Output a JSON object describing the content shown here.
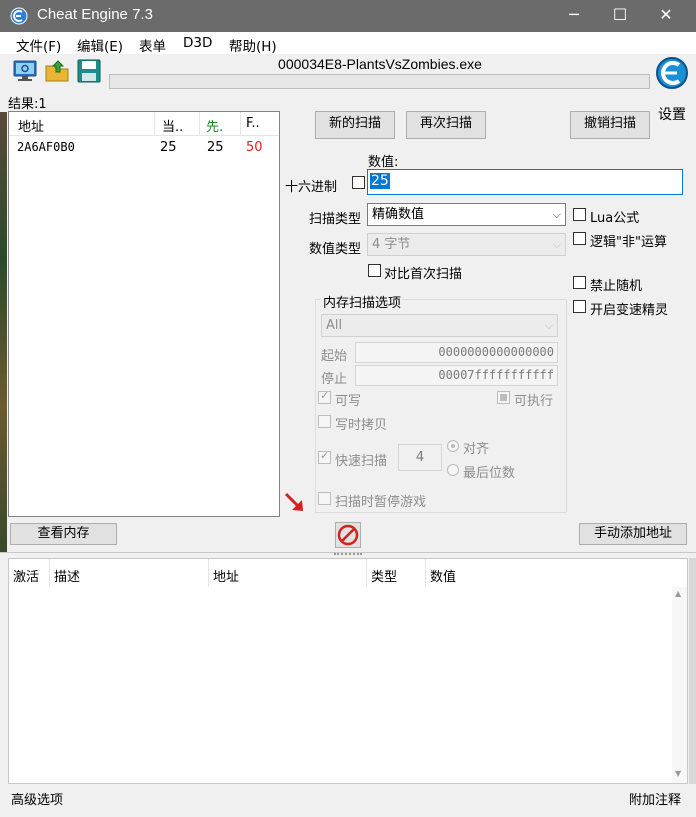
{
  "window": {
    "title": "Cheat Engine 7.3",
    "min": "─",
    "max": "☐",
    "close": "✕"
  },
  "menu": [
    "文件(F)",
    "编辑(E)",
    "表单",
    "D3D",
    "帮助(H)"
  ],
  "toolbar": {
    "process_title": "000034E8-PlantsVsZombies.exe",
    "settings_label": "设置"
  },
  "results": {
    "label": "结果:1",
    "headers": [
      "地址",
      "当..",
      "先.",
      "F.."
    ],
    "rows": [
      {
        "address": "2A6AF0B0",
        "current": "25",
        "previous": "25",
        "first": "50"
      }
    ]
  },
  "scan": {
    "new_scan": "新的扫描",
    "next_scan": "再次扫描",
    "undo_scan": "撤销扫描",
    "value_label": "数值:",
    "value": "25",
    "hex_label": "十六进制",
    "scan_type_label": "扫描类型",
    "scan_type": "精确数值",
    "value_type_label": "数值类型",
    "value_type": "4 字节",
    "compare_first": "对比首次扫描",
    "lua_formula": "Lua公式",
    "not_logic": "逻辑\"非\"运算",
    "no_random": "禁止随机",
    "speedhack": "开启变速精灵"
  },
  "memory": {
    "group_title": "内存扫描选项",
    "region": "All",
    "start_label": "起始",
    "start": "0000000000000000",
    "stop_label": "停止",
    "stop": "00007fffffffffff",
    "writable": "可写",
    "executable": "可执行",
    "copy_on_write": "写时拷贝",
    "fast_scan": "快速扫描",
    "fast_value": "4",
    "align": "对齐",
    "last_digits": "最后位数",
    "pause_game": "扫描时暂停游戏"
  },
  "bottom": {
    "view_memory": "查看内存",
    "add_address": "手动添加地址",
    "headers": [
      "激活",
      "描述",
      "地址",
      "类型",
      "数值"
    ],
    "advanced": "高级选项",
    "extra_comments": "附加注释"
  }
}
